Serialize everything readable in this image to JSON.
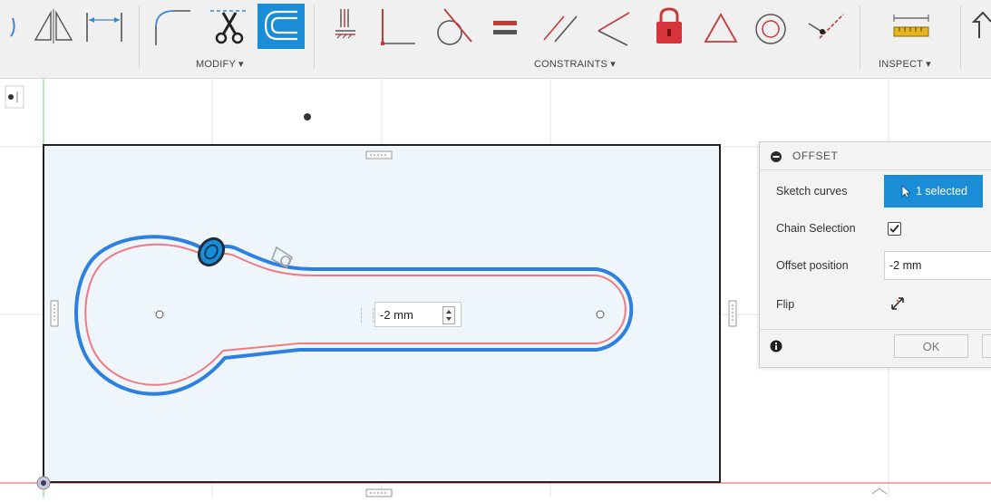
{
  "toolbar": {
    "groups": [
      {
        "label": "MODIFY ▾"
      },
      {
        "label": "CONSTRAINTS ▾"
      },
      {
        "label": "INSPECT ▾"
      }
    ],
    "icons": {
      "create": [
        "spline-icon",
        "mirror-icon",
        "dimension-line-icon"
      ],
      "modify": [
        "fillet-icon",
        "trim-icon",
        "offset-icon"
      ],
      "constraints": [
        "horizontal-vertical-icon",
        "coincident-icon",
        "tangent-icon",
        "equal-icon",
        "parallel-icon",
        "perpendicular-icon",
        "fix-unfix-icon",
        "midpoint-icon",
        "concentric-icon",
        "collinear-icon"
      ],
      "inspect": [
        "measure-icon"
      ],
      "extra": [
        "insert-icon"
      ]
    },
    "active_tool": "offset-icon",
    "accent_color": "#1a8dd6"
  },
  "canvas": {
    "dimension_value": "-2 mm",
    "sketch_colors": {
      "original_curve": "#2d7fe0",
      "offset_preview": "#f07a82",
      "sketch_fill": "#eef6fb"
    }
  },
  "offset_dialog": {
    "title": "OFFSET",
    "sketch_curves_label": "Sketch curves",
    "selection_text": "1 selected",
    "chain_selection_label": "Chain Selection",
    "chain_selection_checked": true,
    "offset_position_label": "Offset position",
    "offset_position_value": "-2 mm",
    "flip_label": "Flip",
    "ok_label": "OK"
  }
}
